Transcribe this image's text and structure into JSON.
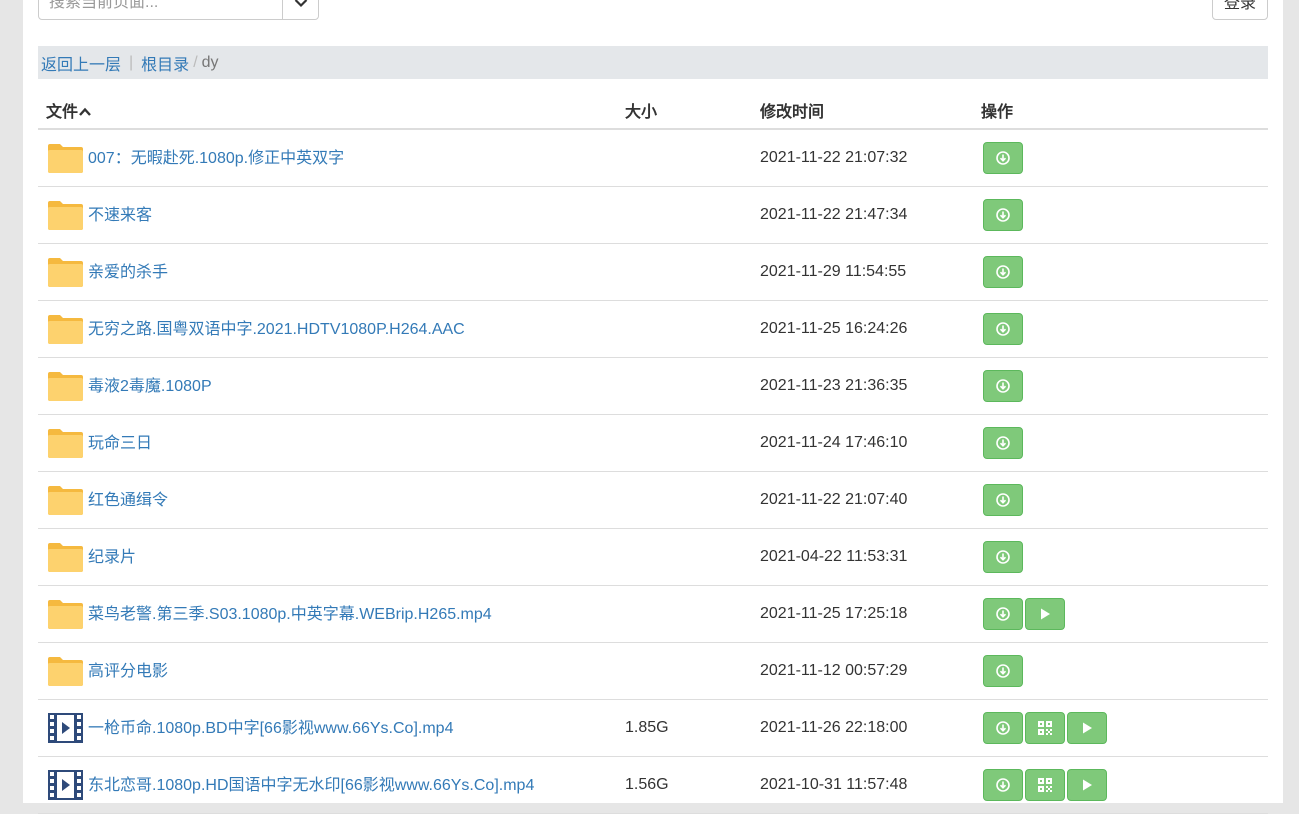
{
  "search": {
    "placeholder": "搜索当前页面..."
  },
  "header": {
    "login_label": "登录"
  },
  "breadcrumb": {
    "back": "返回上一层",
    "separator": "|",
    "root": "根目录",
    "slash": "/",
    "current": "dy"
  },
  "table": {
    "columns": {
      "name": "文件",
      "size": "大小",
      "time": "修改时间",
      "ops": "操作"
    },
    "rows": [
      {
        "type": "folder",
        "name": "007：无暇赴死.1080p.修正中英双字",
        "size": "",
        "time": "2021-11-22 21:07:32",
        "ops": [
          "download-icon"
        ]
      },
      {
        "type": "folder",
        "name": "不速来客",
        "size": "",
        "time": "2021-11-22 21:47:34",
        "ops": [
          "download-icon"
        ]
      },
      {
        "type": "folder",
        "name": "亲爱的杀手",
        "size": "",
        "time": "2021-11-29 11:54:55",
        "ops": [
          "download-icon"
        ]
      },
      {
        "type": "folder",
        "name": "无穷之路.国粤双语中字.2021.HDTV1080P.H264.AAC",
        "size": "",
        "time": "2021-11-25 16:24:26",
        "ops": [
          "download-icon"
        ]
      },
      {
        "type": "folder",
        "name": "毒液2毒魔.1080P",
        "size": "",
        "time": "2021-11-23 21:36:35",
        "ops": [
          "download-icon"
        ]
      },
      {
        "type": "folder",
        "name": "玩命三日",
        "size": "",
        "time": "2021-11-24 17:46:10",
        "ops": [
          "download-icon"
        ]
      },
      {
        "type": "folder",
        "name": "红色通缉令",
        "size": "",
        "time": "2021-11-22 21:07:40",
        "ops": [
          "download-icon"
        ]
      },
      {
        "type": "folder",
        "name": "纪录片",
        "size": "",
        "time": "2021-04-22 11:53:31",
        "ops": [
          "download-icon"
        ]
      },
      {
        "type": "folder",
        "name": "菜鸟老警.第三季.S03.1080p.中英字幕.WEBrip.H265.mp4",
        "size": "",
        "time": "2021-11-25 17:25:18",
        "ops": [
          "download-icon",
          "play-icon"
        ]
      },
      {
        "type": "folder",
        "name": "高评分电影",
        "size": "",
        "time": "2021-11-12 00:57:29",
        "ops": [
          "download-icon"
        ]
      },
      {
        "type": "video",
        "name": "一枪币命.1080p.BD中字[66影视www.66Ys.Co].mp4",
        "size": "1.85G",
        "time": "2021-11-26 22:18:00",
        "ops": [
          "download-icon",
          "qrcode-icon",
          "play-icon"
        ]
      },
      {
        "type": "video",
        "name": "东北恋哥.1080p.HD国语中字无水印[66影视www.66Ys.Co].mp4",
        "size": "1.56G",
        "time": "2021-10-31 11:57:48",
        "ops": [
          "download-icon",
          "qrcode-icon",
          "play-icon"
        ]
      }
    ]
  },
  "colors": {
    "link": "#337ab7",
    "button_green": "#7fc97a",
    "folder": "#fdd26e",
    "video_icon": "#2e4a7a"
  }
}
